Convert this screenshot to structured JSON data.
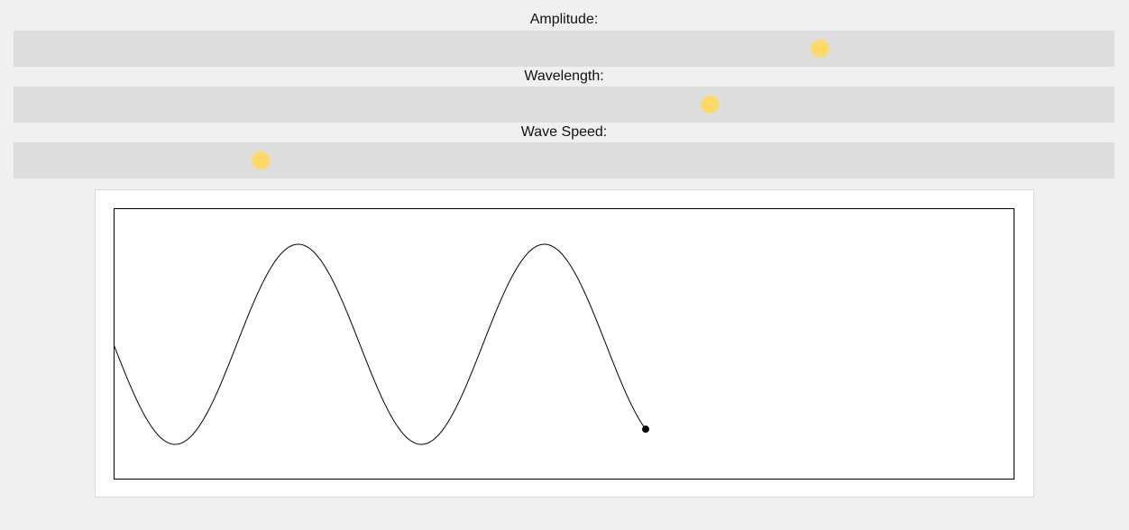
{
  "controls": [
    {
      "id": "amplitude",
      "label": "Amplitude:",
      "value_fraction": 0.732
    },
    {
      "id": "wavelength",
      "label": "Wavelength:",
      "value_fraction": 0.632
    },
    {
      "id": "speed",
      "label": "Wave Speed:",
      "value_fraction": 0.224
    }
  ],
  "colors": {
    "slider_track": "#dddddd",
    "slider_thumb": "#ffd966",
    "wave_line": "#000000",
    "background": "#f0f0f0",
    "panel": "#ffffff"
  },
  "wave": {
    "amplitude_fraction": 0.74,
    "wavelength_fraction": 0.273,
    "drawn_fraction": 0.59,
    "phase_deg": 180,
    "marker_icon": "end-point-dot-icon"
  }
}
